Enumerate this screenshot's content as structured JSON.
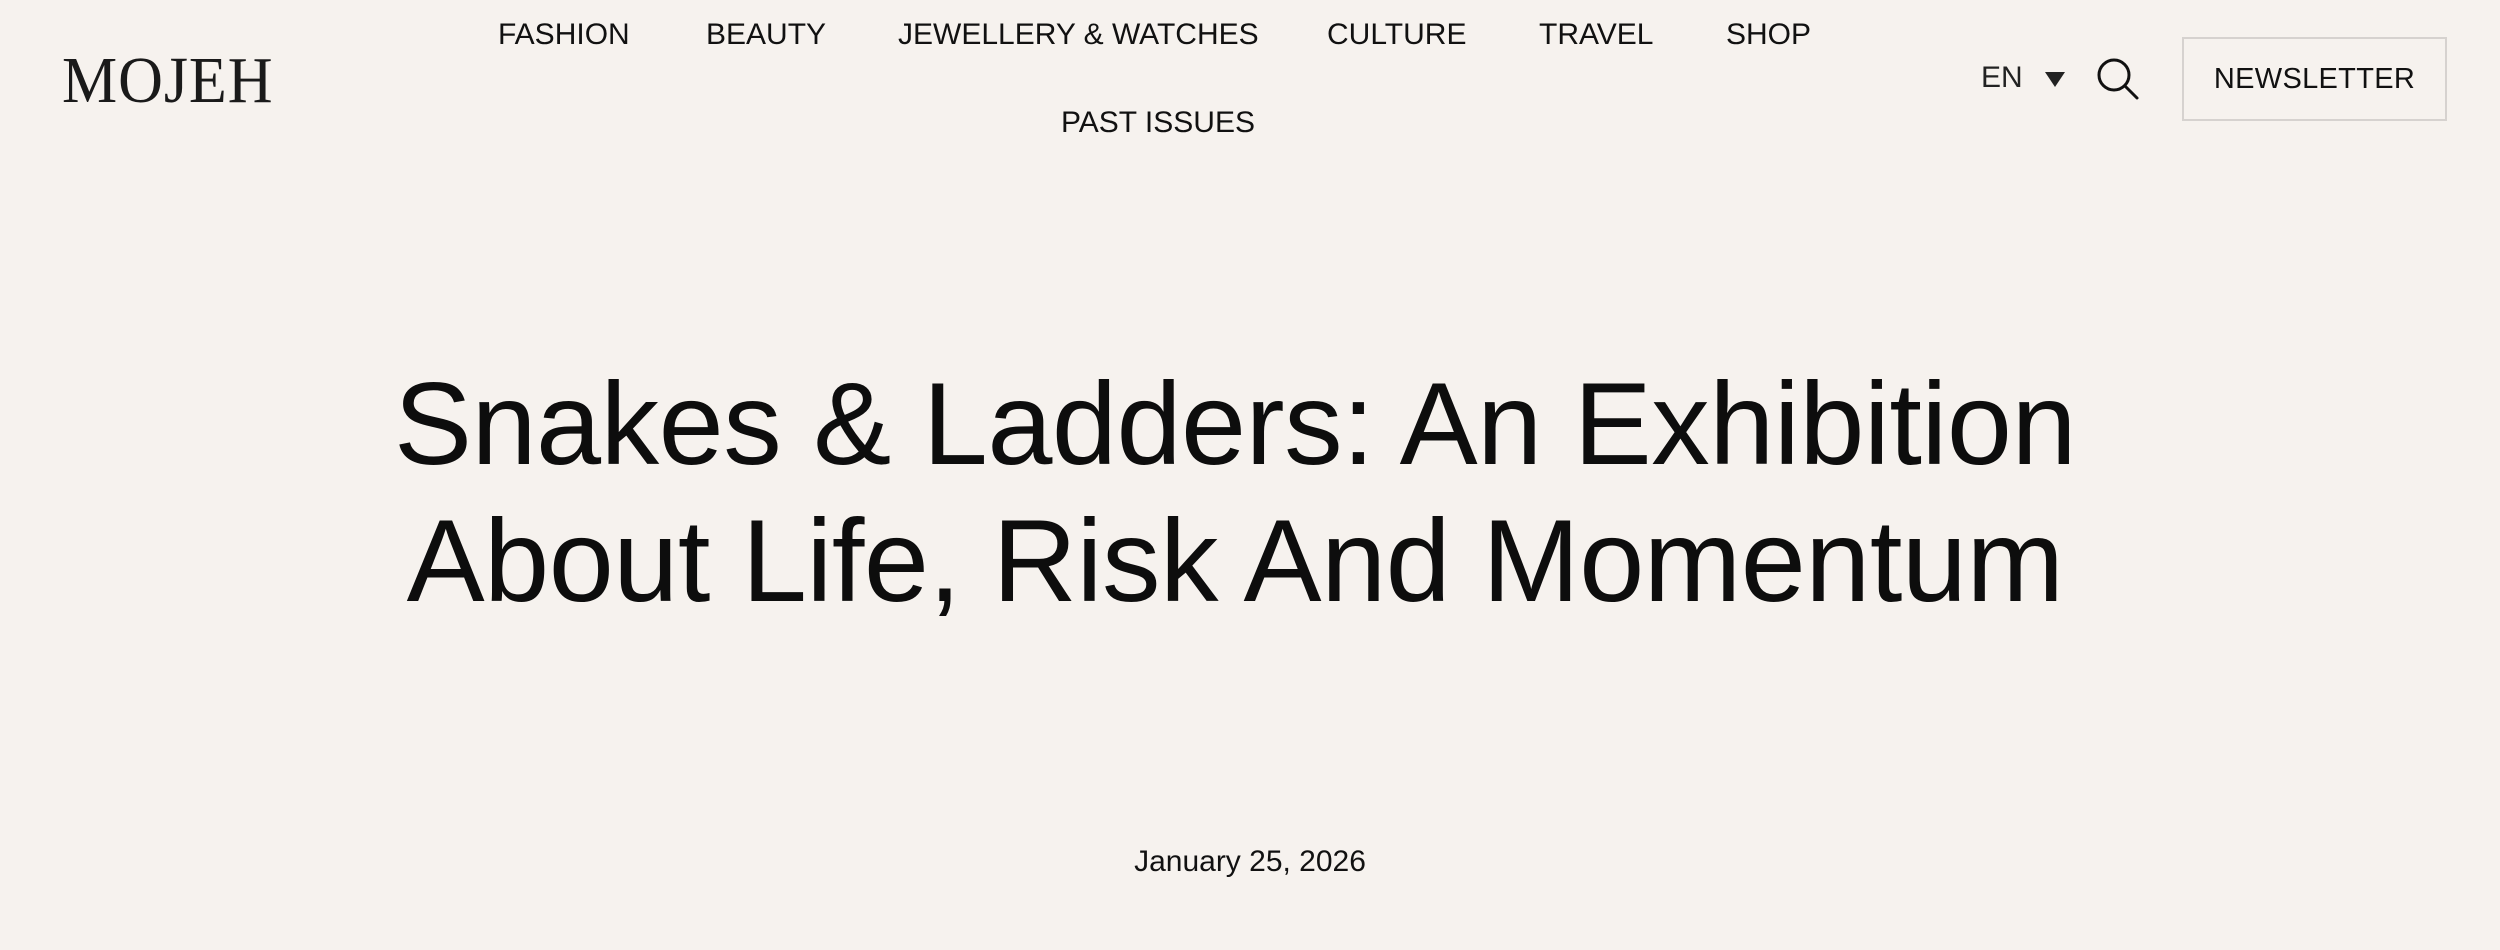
{
  "header": {
    "logo_text": "MOJEH",
    "nav": {
      "row1": [
        "FASHION",
        "BEAUTY",
        "JEWELLERY & WATCHES",
        "CULTURE",
        "TRAVEL",
        "SHOP"
      ],
      "row2": [
        "PAST ISSUES"
      ]
    },
    "language": {
      "selected": "EN",
      "icon": "chevron-down-icon"
    },
    "search_icon": "search-icon",
    "newsletter_label": "NEWSLETTER"
  },
  "article": {
    "title": "Snakes & Ladders: An Exhibition About Life, Risk And Momentum",
    "date": "January 25, 2026"
  }
}
